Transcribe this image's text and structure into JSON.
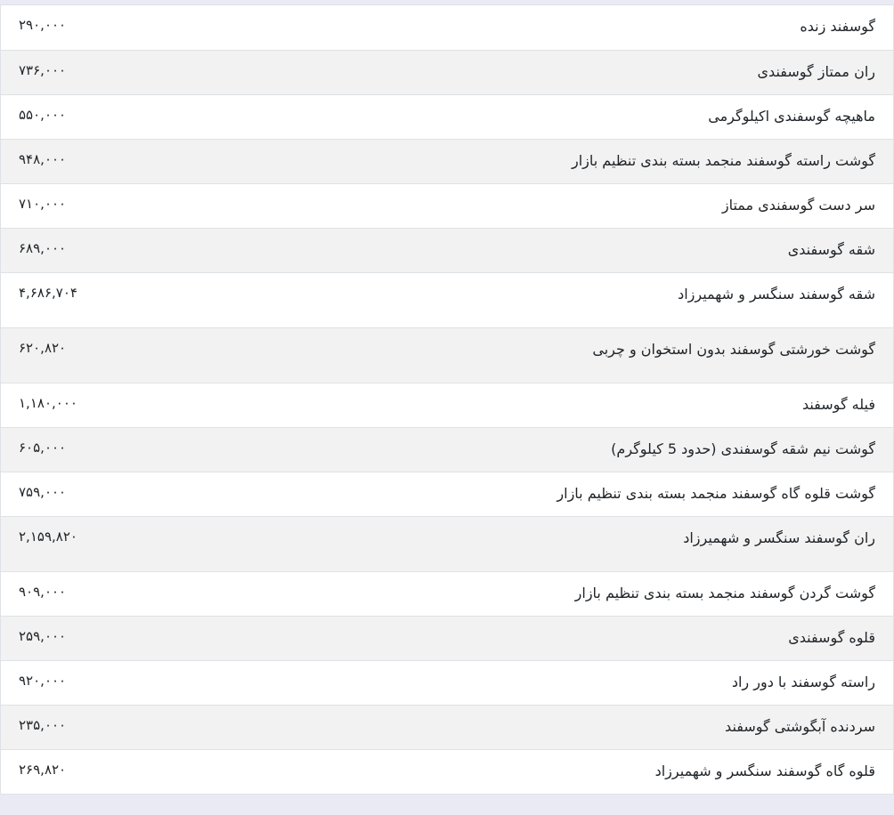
{
  "rows": [
    {
      "name": "گوسفند زنده",
      "price": "۲۹۰,۰۰۰"
    },
    {
      "name": "ران ممتاز گوسفندی",
      "price": "۷۳۶,۰۰۰"
    },
    {
      "name": "ماهیچه گوسفندی اکیلوگرمی",
      "price": "۵۵۰,۰۰۰"
    },
    {
      "name": "گوشت راسته گوسفند منجمد بسته بندی تنظیم بازار",
      "price": "۹۴۸,۰۰۰"
    },
    {
      "name": "سر دست گوسفندی ممتاز",
      "price": "۷۱۰,۰۰۰"
    },
    {
      "name": "شقه گوسفندی",
      "price": "۶۸۹,۰۰۰"
    },
    {
      "name": "شقه گوسفند سنگسر و شهمیرزاد",
      "price": "۴,۶۸۶,۷۰۴"
    },
    {
      "name": "گوشت خورشتی گوسفند بدون استخوان و چربی",
      "price": "۶۲۰,۸۲۰"
    },
    {
      "name": "فیله گوسفند",
      "price": "۱,۱۸۰,۰۰۰"
    },
    {
      "name": "گوشت نیم شقه گوسفندی (حدود 5 کیلوگرم)",
      "price": "۶۰۵,۰۰۰"
    },
    {
      "name": "گوشت قلوه گاه گوسفند منجمد بسته بندی تنظیم بازار",
      "price": "۷۵۹,۰۰۰"
    },
    {
      "name": "ران گوسفند سنگسر و شهمیرزاد",
      "price": "۲,۱۵۹,۸۲۰"
    },
    {
      "name": "گوشت گردن گوسفند منجمد بسته بندی تنظیم بازار",
      "price": "۹۰۹,۰۰۰"
    },
    {
      "name": "قلوه گوسفندی",
      "price": "۲۵۹,۰۰۰"
    },
    {
      "name": "راسته گوسفند با دور راد",
      "price": "۹۲۰,۰۰۰"
    },
    {
      "name": "سردنده آبگوشتی گوسفند",
      "price": "۲۳۵,۰۰۰"
    },
    {
      "name": "قلوه گاه گوسفند سنگسر و شهمیرزاد",
      "price": "۲۶۹,۸۲۰"
    }
  ]
}
